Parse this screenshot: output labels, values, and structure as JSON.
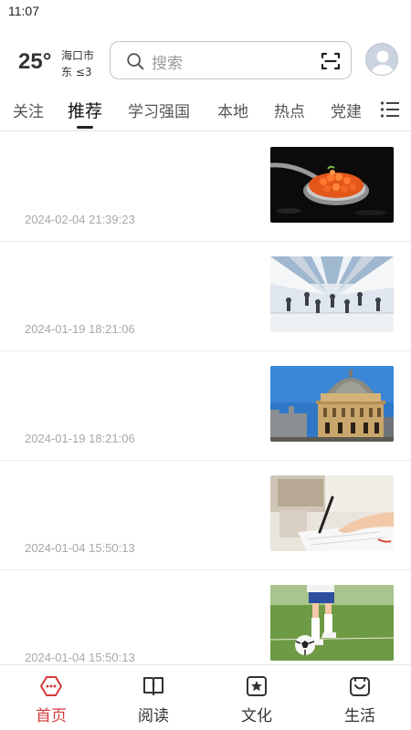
{
  "status_bar": {
    "time": "11:07"
  },
  "weather": {
    "temperature": "25°",
    "city": "海口市",
    "wind": "东 ≤3"
  },
  "search": {
    "placeholder": "搜索",
    "search_icon": "search-icon",
    "scan_icon": "scan-icon"
  },
  "avatar": {
    "icon": "user-avatar"
  },
  "tabs": [
    {
      "label": "关注",
      "active": false
    },
    {
      "label": "推荐",
      "active": true
    },
    {
      "label": "学习强国",
      "active": false
    },
    {
      "label": "本地",
      "active": false
    },
    {
      "label": "热点",
      "active": false
    },
    {
      "label": "党建",
      "active": false
    }
  ],
  "tab_menu_icon": "list-menu-icon",
  "feed": [
    {
      "time": "2024-02-04 21:39:23",
      "thumb": "caviar-spoon-image"
    },
    {
      "time": "2024-01-19 18:21:06",
      "thumb": "white-architecture-image"
    },
    {
      "time": "2024-01-19 18:21:06",
      "thumb": "domed-library-image"
    },
    {
      "time": "2024-01-04 15:50:13",
      "thumb": "hand-writing-image"
    },
    {
      "time": "2024-01-04 15:50:13",
      "thumb": "soccer-ball-image"
    }
  ],
  "bottom_nav": [
    {
      "label": "首页",
      "icon": "home-icon",
      "active": true
    },
    {
      "label": "阅读",
      "icon": "book-icon",
      "active": false
    },
    {
      "label": "文化",
      "icon": "star-badge-icon",
      "active": false
    },
    {
      "label": "生活",
      "icon": "smile-bag-icon",
      "active": false
    }
  ],
  "colors": {
    "accent": "#d43a3a",
    "muted_text": "#a8a8a8",
    "divider": "#ececec"
  }
}
